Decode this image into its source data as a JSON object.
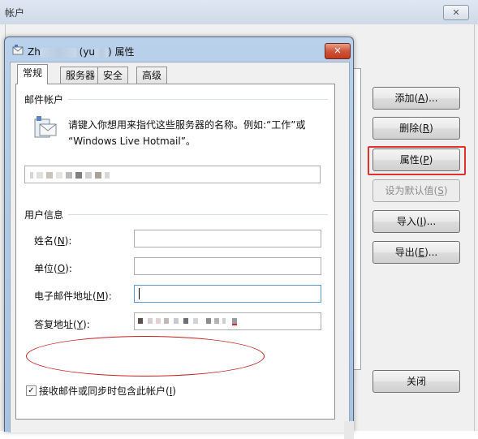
{
  "accounts_window": {
    "title": "帐户",
    "close_glyph": "✕",
    "buttons": {
      "add": "添加(A)...",
      "remove": "删除(R)",
      "properties": "属性(P)",
      "set_default": "设为默认值(S)",
      "import": "导入(I)...",
      "export": "导出(E)...",
      "close": "关闭"
    }
  },
  "properties_dialog": {
    "title_prefix": "Zh",
    "title_middle": " (yu",
    "title_suffix": ") 属性",
    "close_glyph": "✕",
    "tabs": [
      "常规",
      "服务器",
      "安全",
      "高级"
    ],
    "mail_account_group": "邮件帐户",
    "instruction_line1": "请键入你想用来指代这些服务器的名称。例如:“工作”或",
    "instruction_line2": "“Windows Live Hotmail”。",
    "user_info_group": "用户信息",
    "fields": {
      "name_label": "姓名(N):",
      "organization_label": "单位(O):",
      "email_label": "电子邮件地址(M):",
      "reply_label": "答复地址(Y):"
    },
    "receive_checkbox_label": "接收邮件或同步时包含此帐户(I)",
    "receive_checked": true
  },
  "colors": {
    "highlight_red": "#e03030",
    "title_bar_blue": "#b9d1ea"
  },
  "icons": [
    "window-icon",
    "account-icon",
    "close-icon"
  ]
}
